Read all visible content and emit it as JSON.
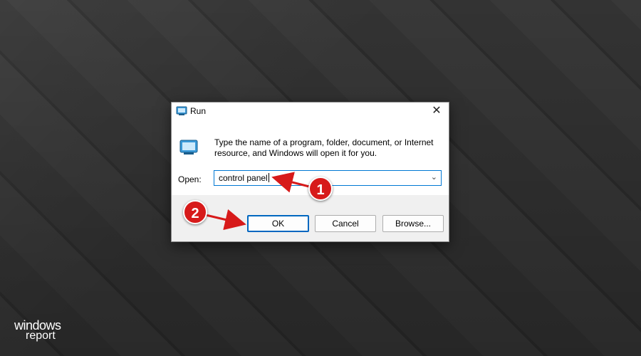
{
  "dialog": {
    "title": "Run",
    "description": "Type the name of a program, folder, document, or Internet resource, and Windows will open it for you.",
    "open_label": "Open:",
    "command_value": "control panel",
    "close_glyph": "✕",
    "dropdown_glyph": "⌄",
    "buttons": {
      "ok": "OK",
      "cancel": "Cancel",
      "browse": "Browse..."
    }
  },
  "annotations": {
    "step1": "1",
    "step2": "2",
    "color": "#d71a1a"
  },
  "watermark": {
    "line1": "windows",
    "line2": "report"
  },
  "icons": {
    "title": "run-icon",
    "content": "run-icon",
    "close": "close-icon",
    "dropdown": "chevron-down-icon"
  }
}
